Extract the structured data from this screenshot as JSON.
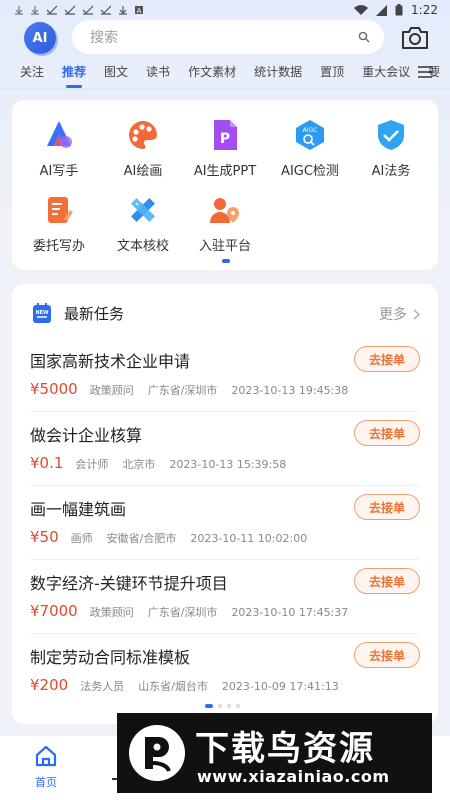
{
  "status_bar": {
    "time": "1:22"
  },
  "header": {
    "logo_text": "AI",
    "search_placeholder": "搜索"
  },
  "tabs": [
    {
      "label": "关注",
      "active": false
    },
    {
      "label": "推荐",
      "active": true
    },
    {
      "label": "图文",
      "active": false
    },
    {
      "label": "读书",
      "active": false
    },
    {
      "label": "作文素材",
      "active": false
    },
    {
      "label": "统计数据",
      "active": false
    },
    {
      "label": "置顶",
      "active": false
    },
    {
      "label": "重大会议",
      "active": false
    },
    {
      "label": "要",
      "active": false
    }
  ],
  "features": [
    {
      "label": "AI写手",
      "icon": "ai-writer-icon"
    },
    {
      "label": "AI绘画",
      "icon": "palette-icon"
    },
    {
      "label": "AI生成PPT",
      "icon": "ppt-icon"
    },
    {
      "label": "AIGC检测",
      "icon": "aigc-detect-icon"
    },
    {
      "label": "AI法务",
      "icon": "shield-check-icon"
    },
    {
      "label": "委托写办",
      "icon": "write-edit-icon"
    },
    {
      "label": "文本核校",
      "icon": "ruler-pencil-icon"
    },
    {
      "label": "入驻平台",
      "icon": "user-location-icon"
    }
  ],
  "tasks_section": {
    "title": "最新任务",
    "more": "更多",
    "items": [
      {
        "title": "国家高新技术企业申请",
        "price": "¥5000",
        "role": "政策顾问",
        "location": "广东省/深圳市",
        "time": "2023-10-13 19:45:38",
        "action": "去接单"
      },
      {
        "title": "做会计企业核算",
        "price": "¥0.1",
        "role": "会计师",
        "location": "北京市",
        "time": "2023-10-13 15:39:58",
        "action": "去接单"
      },
      {
        "title": "画一幅建筑画",
        "price": "¥50",
        "role": "画师",
        "location": "安徽省/合肥市",
        "time": "2023-10-11 10:02:00",
        "action": "去接单"
      },
      {
        "title": "数字经济-关键环节提升项目",
        "price": "¥7000",
        "role": "政策顾问",
        "location": "广东省/深圳市",
        "time": "2023-10-10 17:45:37",
        "action": "去接单"
      },
      {
        "title": "制定劳动合同标准模板",
        "price": "¥200",
        "role": "法务人员",
        "location": "山东省/烟台市",
        "time": "2023-10-09 17:41:13",
        "action": "去接单"
      }
    ]
  },
  "bottom_nav": {
    "home_label": "首页"
  },
  "watermark": {
    "title": "下载鸟资源",
    "url": "www.xiazainiao.com"
  },
  "colors": {
    "accent": "#2f6af2",
    "price": "#e4462e",
    "action": "#e8743a"
  }
}
